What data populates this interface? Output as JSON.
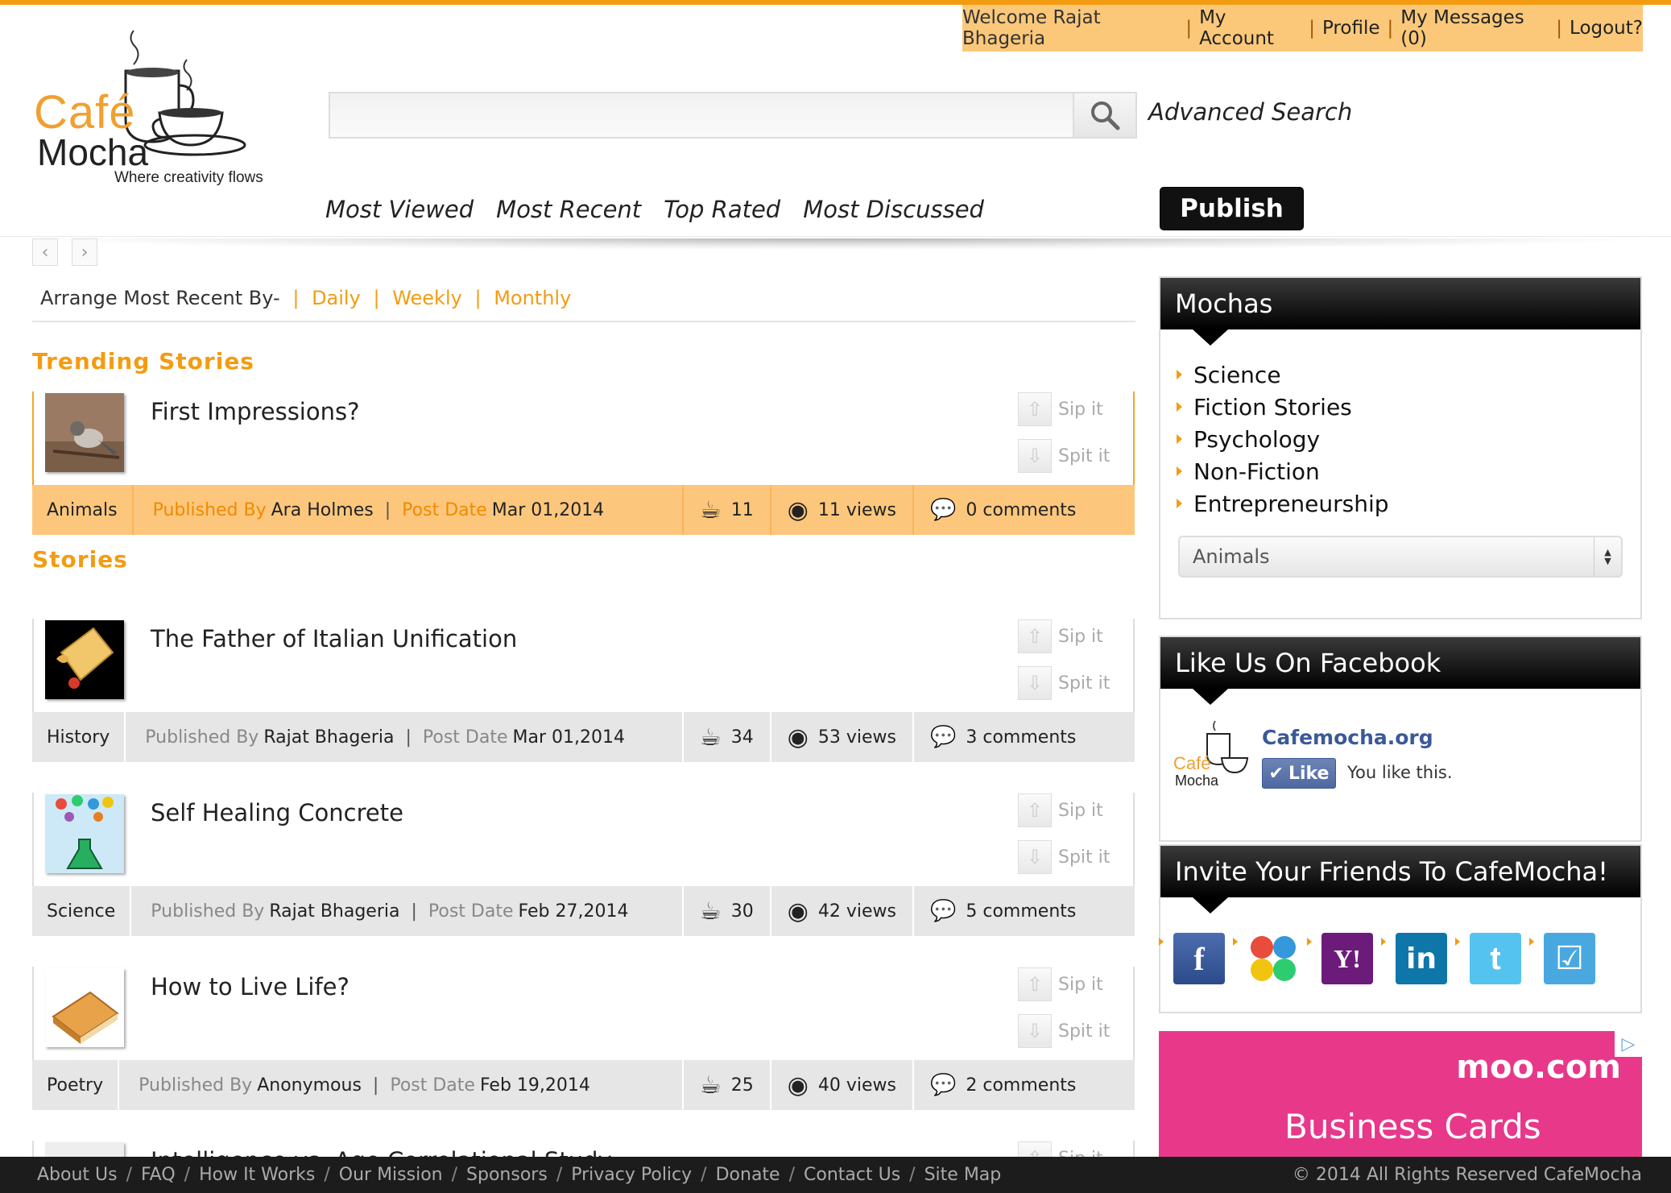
{
  "account": {
    "welcome": "Welcome Rajat Bhageria",
    "links": [
      "My Account",
      "Profile",
      "My Messages (0)",
      "Logout?"
    ]
  },
  "logo": {
    "line1": "Café",
    "line2": "Mocha",
    "tagline": "Where creativity flows"
  },
  "search": {
    "placeholder": "",
    "advanced": "Advanced Search"
  },
  "nav": [
    "Most Viewed",
    "Most Recent",
    "Top Rated",
    "Most Discussed"
  ],
  "publish_label": "Publish",
  "arrange": {
    "label": "Arrange Most Recent By-",
    "options": [
      "Daily",
      "Weekly",
      "Monthly"
    ]
  },
  "sections": {
    "trending": "Trending Stories",
    "stories": "Stories"
  },
  "labels": {
    "sip": "Sip it",
    "spit": "Spit it",
    "published_by": "Published By",
    "post_date": "Post Date"
  },
  "trending": [
    {
      "title": "First Impressions?",
      "category": "Animals",
      "author": "Ara Holmes",
      "date": "Mar 01,2014",
      "sips": "11",
      "views": "11 views",
      "comments": "0 comments"
    }
  ],
  "stories": [
    {
      "title": "The Father of Italian Unification",
      "category": "History",
      "author": "Rajat Bhageria",
      "date": "Mar 01,2014",
      "sips": "34",
      "views": "53 views",
      "comments": "3 comments"
    },
    {
      "title": "Self Healing Concrete",
      "category": "Science",
      "author": "Rajat Bhageria",
      "date": "Feb 27,2014",
      "sips": "30",
      "views": "42 views",
      "comments": "5 comments"
    },
    {
      "title": "How to Live Life?",
      "category": "Poetry",
      "author": "Anonymous",
      "date": "Feb 19,2014",
      "sips": "25",
      "views": "40 views",
      "comments": "2 comments"
    },
    {
      "title": "Intelligence vs. Age Correlational Study",
      "category": "",
      "author": "",
      "date": "",
      "sips": "",
      "views": "",
      "comments": ""
    }
  ],
  "mochas": {
    "title": "Mochas",
    "items": [
      "Science",
      "Fiction Stories",
      "Psychology",
      "Non-Fiction",
      "Entrepreneurship"
    ],
    "select_value": "Animals"
  },
  "facebook": {
    "title": "Like Us On Facebook",
    "page": "Cafemocha.org",
    "like": "Like",
    "status": "You like this."
  },
  "invite": {
    "title": "Invite Your Friends To CafeMocha!",
    "icons": [
      "facebook-icon",
      "google-icon",
      "yahoo-icon",
      "linkedin-icon",
      "twitter-icon",
      "check-icon"
    ]
  },
  "ad": {
    "brand": "moo.com",
    "text": "Business Cards"
  },
  "footer": {
    "links": [
      "About Us",
      "FAQ",
      "How It Works",
      "Our Mission",
      "Sponsors",
      "Privacy Policy",
      "Donate",
      "Contact Us",
      "Site Map"
    ],
    "copyright": "© 2014 All Rights Reserved CafeMocha"
  },
  "colors": {
    "accent": "#f39c12",
    "trend_bar": "#fcc77c",
    "facebook": "#3b5998"
  }
}
